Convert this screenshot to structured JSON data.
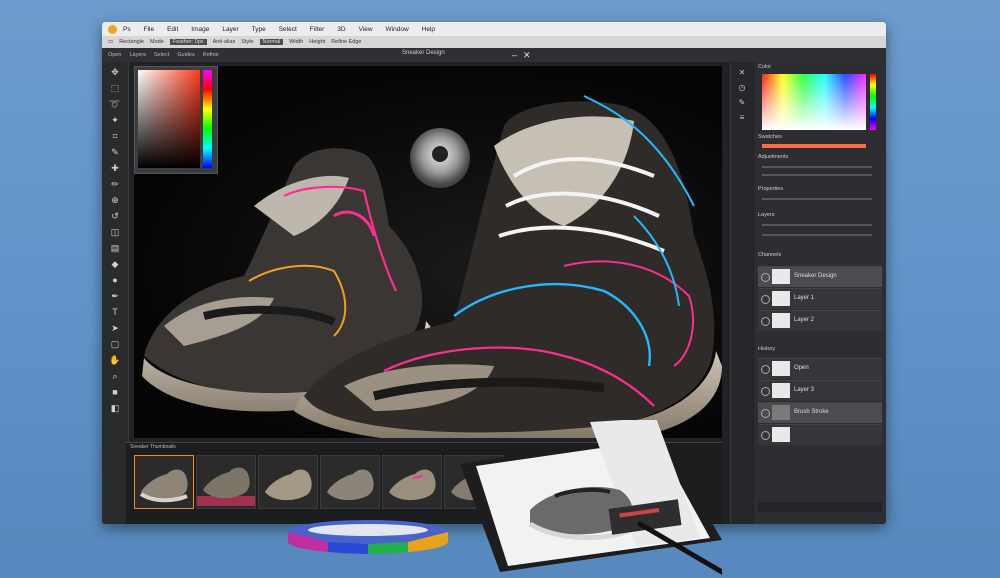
{
  "menu": {
    "items": [
      "Ps",
      "File",
      "Edit",
      "Image",
      "Layer",
      "Type",
      "Select",
      "Filter",
      "3D",
      "View",
      "Window",
      "Help"
    ]
  },
  "options_bar": {
    "items": [
      "Rectangle",
      "Mode",
      "Feather: 0px",
      "Anti-alias",
      "Style",
      "Normal",
      "Width",
      "Height",
      "Refine Edge"
    ]
  },
  "document_tabs": {
    "items": [
      "Open",
      "Layers",
      "Select",
      "Guides",
      "Refine"
    ],
    "title": "Sneaker Design"
  },
  "filmstrip": {
    "label": "Sneaker Thumbnails"
  },
  "right_panel": {
    "color_label": "Color",
    "swatches_label": "Swatches",
    "adjustments_label": "Adjustments",
    "properties_label": "Properties",
    "layers_label": "Layers",
    "channels_label": "Channels",
    "layers": [
      "Sneaker Design",
      "Layer 1",
      "Layer 2"
    ],
    "history_label": "History",
    "history": [
      "Open",
      "Layer 3",
      "Brush Stroke"
    ]
  },
  "colors": {
    "accent": "#f08a24",
    "neon_pink": "#ff2d8e",
    "neon_blue": "#25b8ff"
  }
}
